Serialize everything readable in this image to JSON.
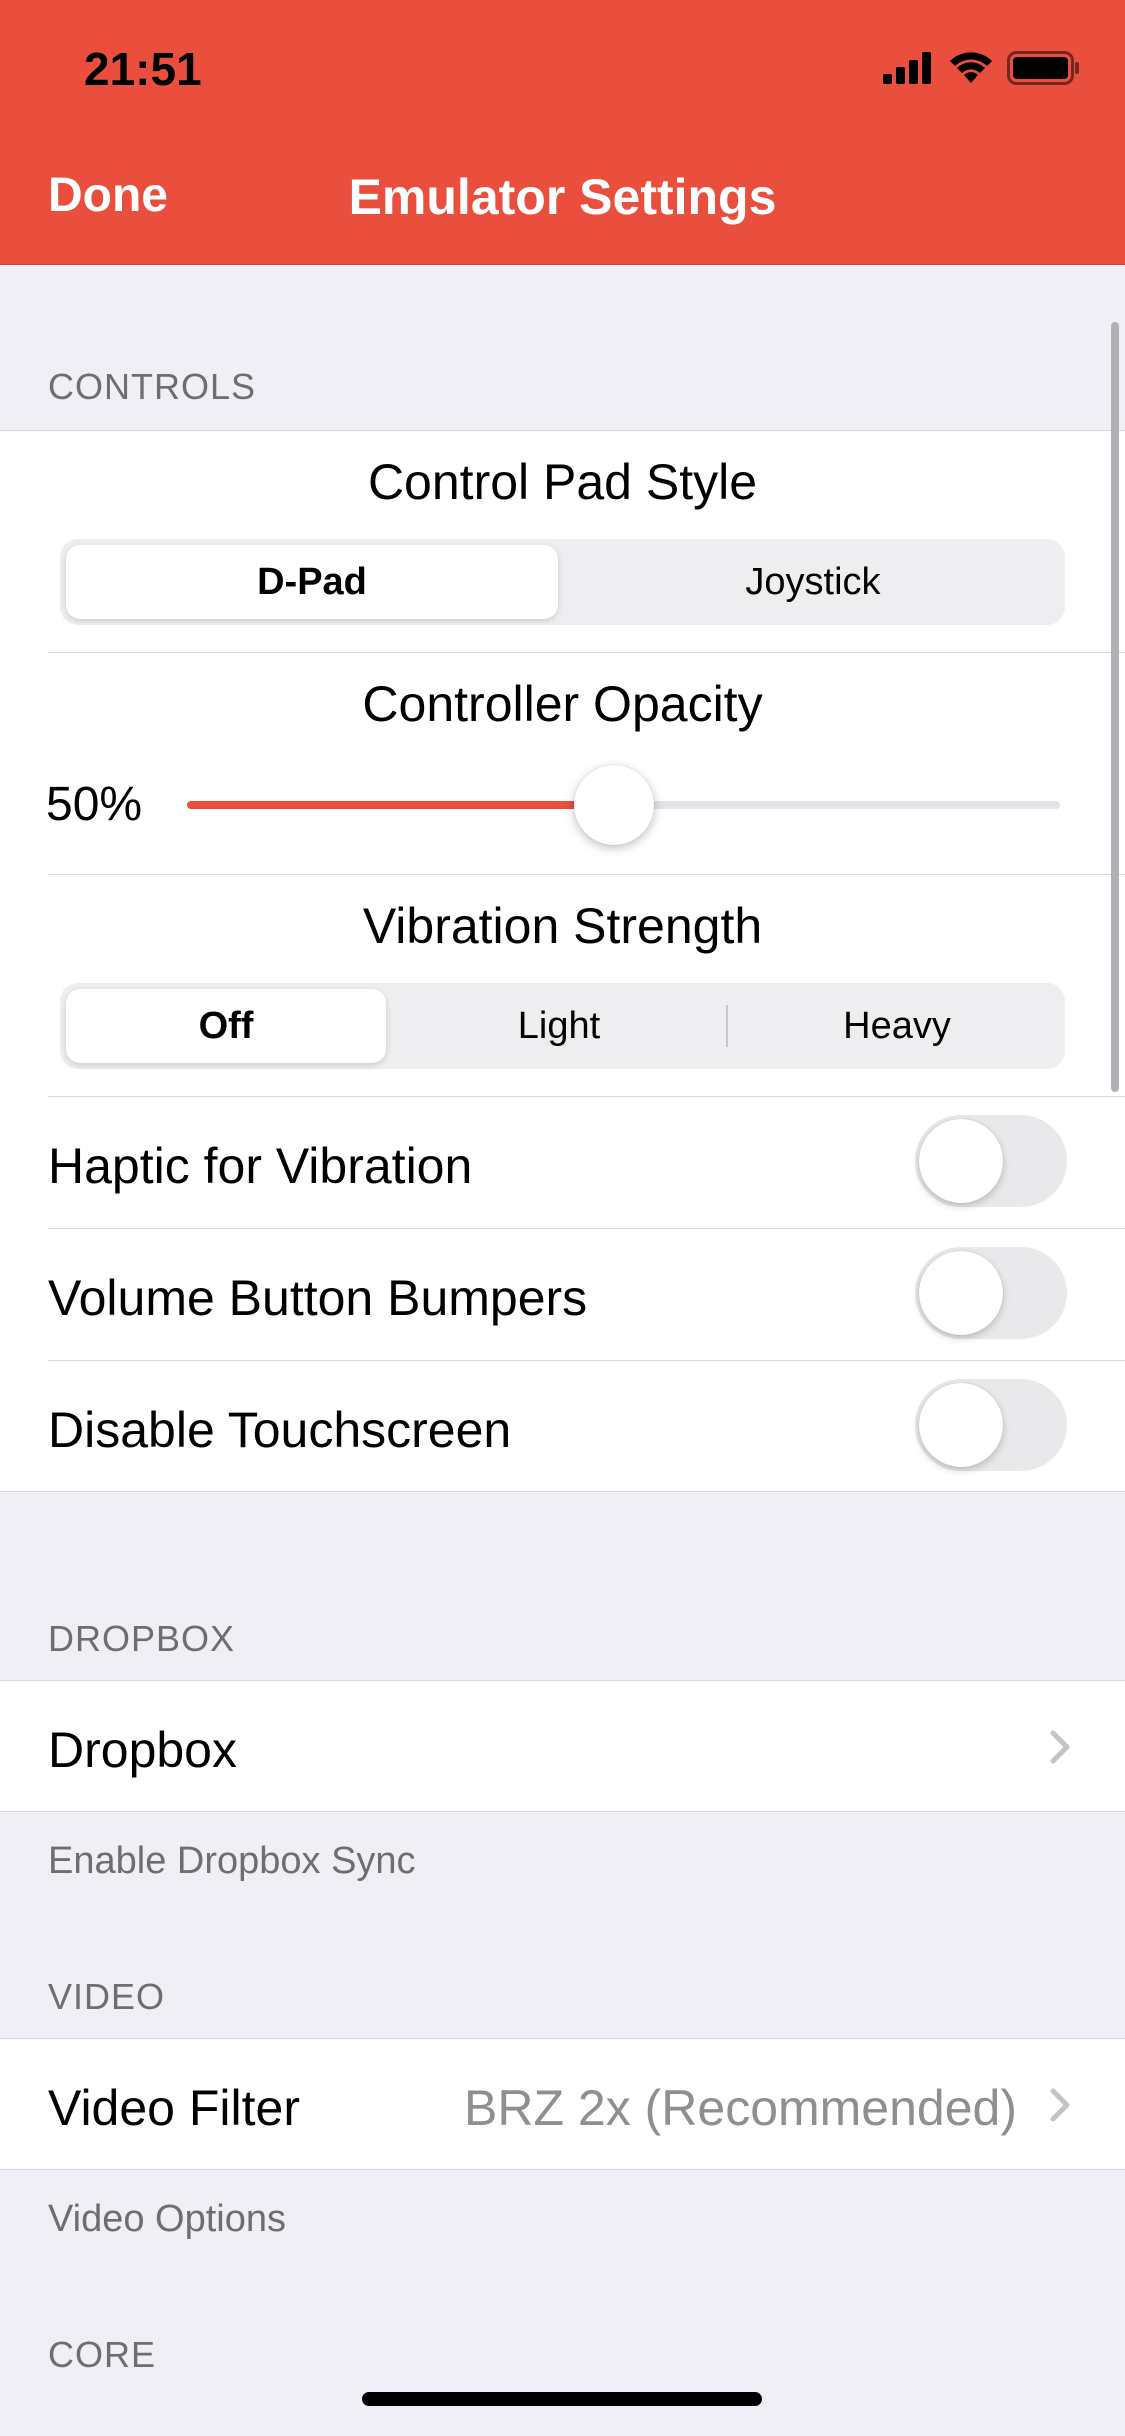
{
  "status_bar": {
    "time": "21:51"
  },
  "nav": {
    "done_label": "Done",
    "title": "Emulator Settings"
  },
  "controls": {
    "header": "CONTROLS",
    "control_pad_style": {
      "title": "Control Pad Style",
      "options": [
        "D-Pad",
        "Joystick"
      ],
      "selected": "D-Pad"
    },
    "controller_opacity": {
      "title": "Controller Opacity",
      "value_label": "50%",
      "value": 0.5
    },
    "vibration_strength": {
      "title": "Vibration Strength",
      "options": [
        "Off",
        "Light",
        "Heavy"
      ],
      "selected": "Off"
    },
    "toggles": [
      {
        "label": "Haptic for Vibration",
        "on": false
      },
      {
        "label": "Volume Button Bumpers",
        "on": false
      },
      {
        "label": "Disable Touchscreen",
        "on": false
      }
    ]
  },
  "dropbox": {
    "header": "DROPBOX",
    "row_label": "Dropbox",
    "footer": "Enable Dropbox Sync"
  },
  "video": {
    "header": "VIDEO",
    "row_label": "Video Filter",
    "row_value": "BRZ 2x (Recommended)",
    "footer": "Video Options"
  },
  "core": {
    "header": "CORE"
  },
  "colors": {
    "accent": "#ea4f3d",
    "background": "#f0eff5",
    "secondary_text": "#6d6d72"
  },
  "icons": [
    "signal-icon",
    "wifi-icon",
    "battery-icon",
    "chevron-right-icon"
  ]
}
